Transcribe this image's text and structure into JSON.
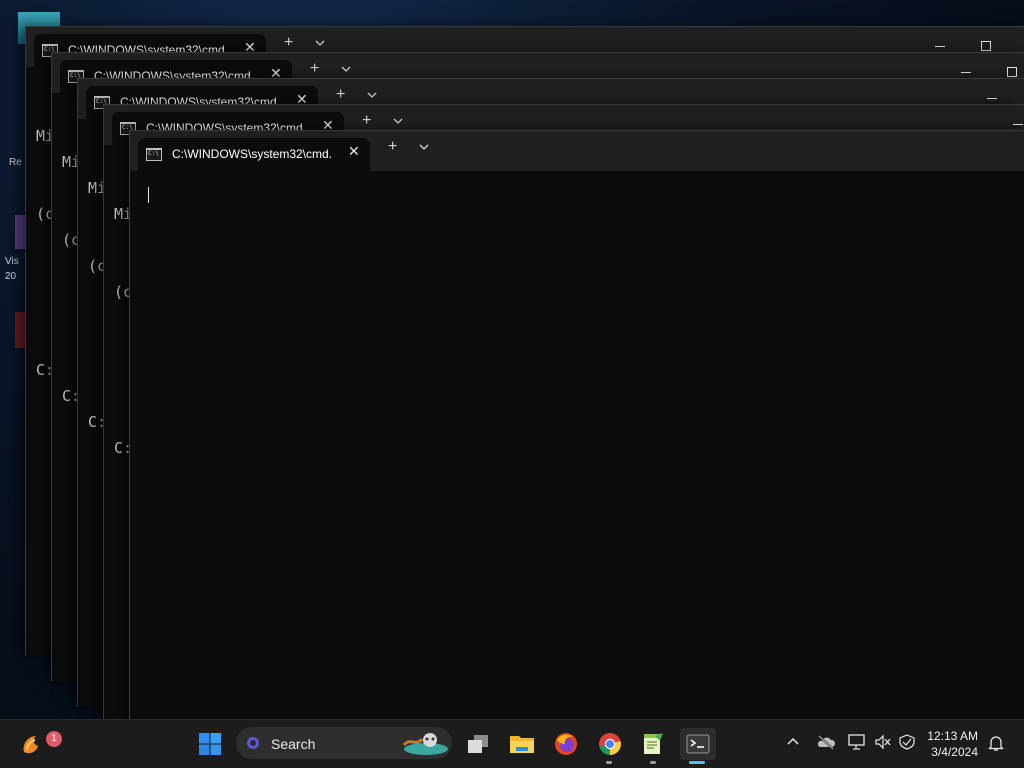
{
  "desktop": {
    "icon_labels": [
      "Re",
      "Vis",
      "20"
    ]
  },
  "windows": [
    {
      "tab_title": "C:\\WINDOWS\\system32\\cmd.",
      "lines": [
        "Mi",
        "(c",
        "",
        "C:"
      ]
    },
    {
      "tab_title": "C:\\WINDOWS\\system32\\cmd.",
      "lines": [
        "Mi",
        "(c",
        "",
        "C:"
      ]
    },
    {
      "tab_title": "C:\\WINDOWS\\system32\\cmd.",
      "lines": [
        "Mi",
        "(c",
        "",
        "C:"
      ]
    },
    {
      "tab_title": "C:\\WINDOWS\\system32\\cmd.",
      "lines": [
        "Mi",
        "(c",
        "",
        "C:"
      ]
    },
    {
      "tab_title": "C:\\WINDOWS\\system32\\cmd.",
      "lines": [
        ""
      ]
    }
  ],
  "taskbar": {
    "widgets_badge": "1",
    "search_label": "Search",
    "clock_time": "12:13 AM",
    "clock_date": "3/4/2024",
    "pinned": [
      "start-icon",
      "task-view-icon",
      "file-explorer-icon",
      "firefox-icon",
      "chrome-icon",
      "notepad-plus-icon",
      "terminal-icon"
    ],
    "tray": [
      "chevron-up-icon",
      "onedrive-icon",
      "network-icon",
      "volume-muted-icon",
      "shield-icon",
      "notification-bell-icon"
    ]
  },
  "colors": {
    "terminal_bg": "#0c0c0c",
    "titlebar_bg": "#202020",
    "taskbar_bg": "#1c1c1c",
    "start_blue": "#2f8ff0"
  }
}
